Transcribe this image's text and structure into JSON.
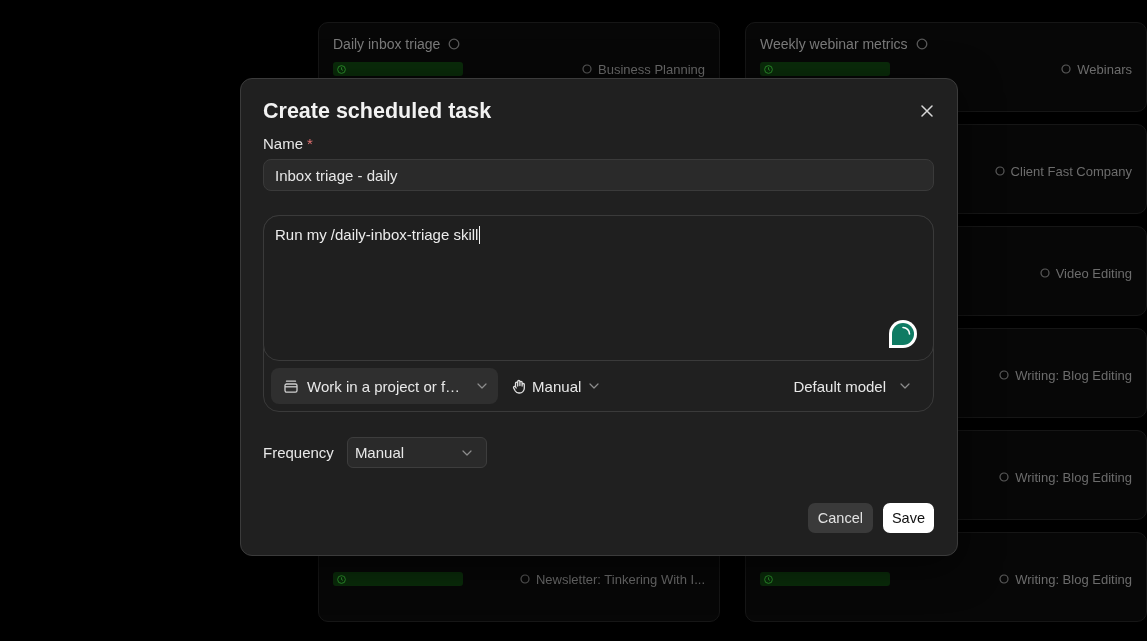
{
  "backdrop": {
    "columns": [
      {
        "cards": [
          {
            "title": "Daily inbox triage",
            "scheduled": true,
            "tag": "Business Planning"
          },
          {
            "scheduled": true,
            "tag": "Newsletter: Tinkering With I..."
          }
        ]
      },
      {
        "cards": [
          {
            "title": "Weekly webinar metrics",
            "scheduled": true,
            "tag": "Webinars"
          },
          {
            "scheduled": false,
            "tag": "Client Fast Company"
          },
          {
            "scheduled": false,
            "tag": "Video Editing"
          },
          {
            "scheduled": false,
            "tag": "Writing: Blog Editing"
          },
          {
            "scheduled": false,
            "tag": "Writing: Blog Editing"
          },
          {
            "scheduled": true,
            "tag": "Writing: Blog Editing"
          }
        ]
      }
    ]
  },
  "dialog": {
    "title": "Create scheduled task",
    "name_field": {
      "label": "Name",
      "required_mark": "*",
      "value": "Inbox triage - daily"
    },
    "prompt": {
      "value": "Run my /daily-inbox-triage skill",
      "focused": true
    },
    "toolbar": {
      "project": "Work in a project or f…",
      "permission": "Manual",
      "model": "Default model"
    },
    "frequency": {
      "label": "Frequency",
      "value": "Manual"
    },
    "buttons": [
      {
        "label": "Cancel",
        "kind": "secondary"
      },
      {
        "label": "Save",
        "kind": "primary"
      }
    ]
  }
}
